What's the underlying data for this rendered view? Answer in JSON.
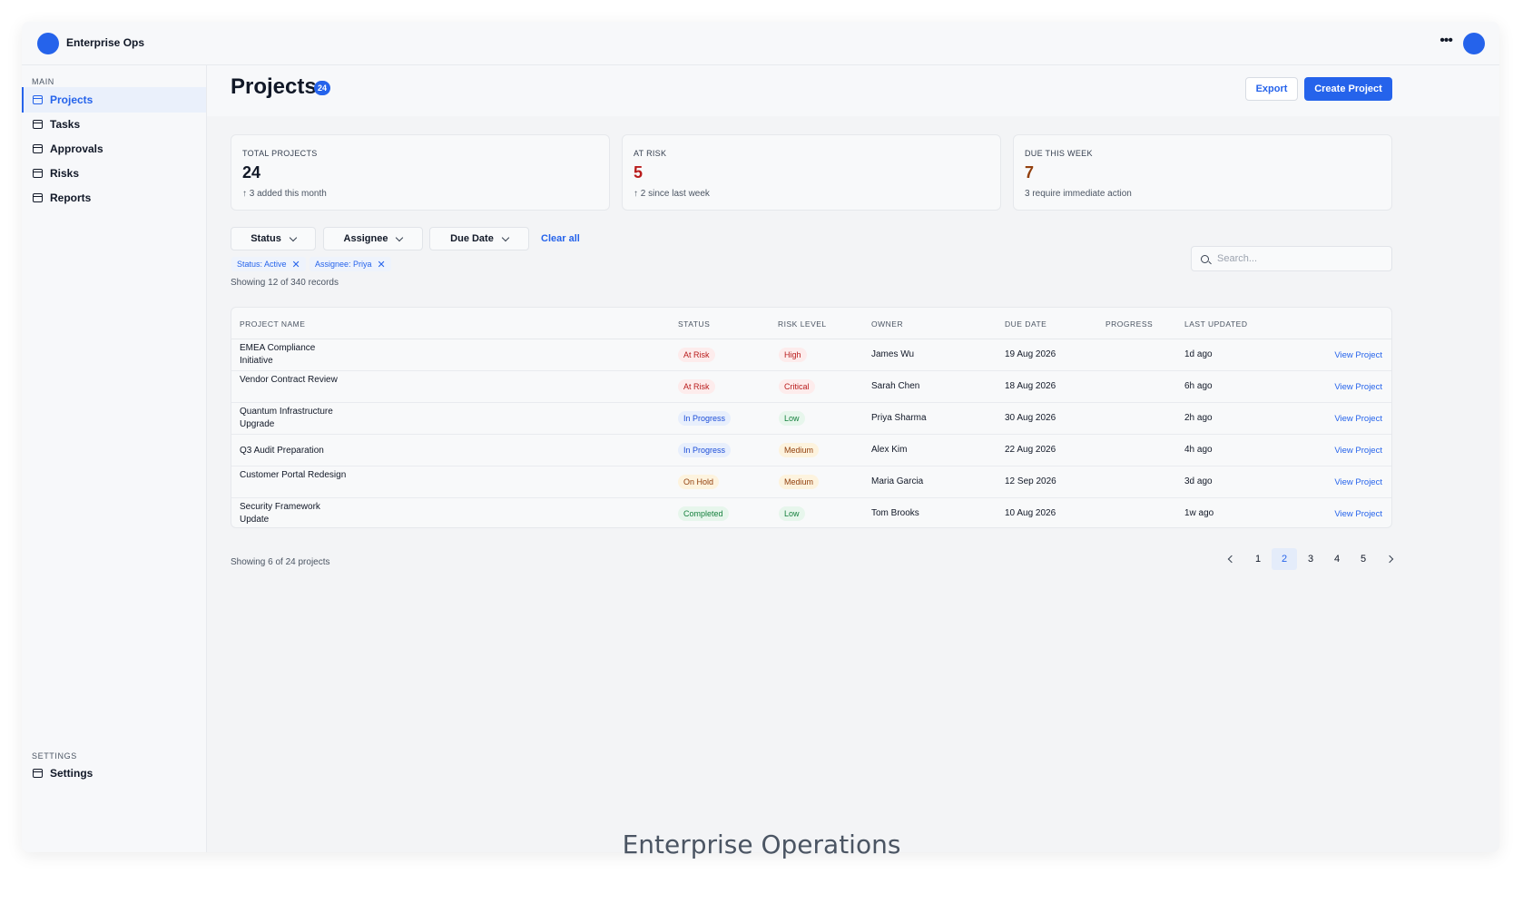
{
  "app": {
    "title": "Enterprise Ops"
  },
  "sidebar": {
    "main_section": "MAIN",
    "items": [
      {
        "label": "Projects",
        "active": true
      },
      {
        "label": "Tasks"
      },
      {
        "label": "Approvals"
      },
      {
        "label": "Risks"
      },
      {
        "label": "Reports"
      }
    ],
    "settings_section": "SETTINGS",
    "settings_item": "Settings"
  },
  "header": {
    "title": "Projects",
    "count_badge": "24",
    "export_label": "Export",
    "create_label": "Create Project"
  },
  "stats": [
    {
      "label": "TOTAL PROJECTS",
      "value": "24",
      "sub": "↑ 3 added this month"
    },
    {
      "label": "AT RISK",
      "value": "5",
      "sub": "↑ 2 since last week",
      "color": "#b91c1c"
    },
    {
      "label": "DUE THIS WEEK",
      "value": "7",
      "sub": "3 require immediate action",
      "color": "#92400e"
    }
  ],
  "filters": {
    "buttons": [
      "Status",
      "Assignee",
      "Due Date"
    ],
    "clear_all": "Clear all",
    "chips": [
      "Status: Active",
      "Assignee: Priya"
    ],
    "showing_records": "Showing 12 of 340 records"
  },
  "search": {
    "placeholder": "Search..."
  },
  "table": {
    "columns": [
      "PROJECT NAME",
      "STATUS",
      "RISK LEVEL",
      "OWNER",
      "DUE DATE",
      "PROGRESS",
      "LAST UPDATED"
    ],
    "rows": [
      {
        "name": "EMEA Compliance Initiative",
        "status": "At Risk",
        "risk": "High",
        "owner": "James Wu",
        "due": "19 Aug 2026",
        "updated": "1d ago",
        "action": "View Project"
      },
      {
        "name": "Vendor Contract Review",
        "status": "At Risk",
        "risk": "Critical",
        "owner": "Sarah Chen",
        "due": "18 Aug 2026",
        "updated": "6h ago",
        "action": "View Project"
      },
      {
        "name": "Quantum Infrastructure Upgrade",
        "status": "In Progress",
        "risk": "Low",
        "owner": "Priya Sharma",
        "due": "30 Aug 2026",
        "updated": "2h ago",
        "action": "View Project"
      },
      {
        "name": "Q3 Audit Preparation",
        "status": "In Progress",
        "risk": "Medium",
        "owner": "Alex Kim",
        "due": "22 Aug 2026",
        "updated": "4h ago",
        "action": "View Project"
      },
      {
        "name": "Customer Portal Redesign",
        "status": "On Hold",
        "risk": "Medium",
        "owner": "Maria Garcia",
        "due": "12 Sep 2026",
        "updated": "3d ago",
        "action": "View Project"
      },
      {
        "name": "Security Framework Update",
        "status": "Completed",
        "risk": "Low",
        "owner": "Tom Brooks",
        "due": "10 Aug 2026",
        "updated": "1w ago",
        "action": "View Project"
      }
    ]
  },
  "pagination": {
    "showing": "Showing 6 of 24 projects",
    "pages": [
      "1",
      "2",
      "3",
      "4",
      "5"
    ],
    "current": "2"
  },
  "caption": "Enterprise Operations",
  "colors": {
    "accent": "#2563eb"
  }
}
